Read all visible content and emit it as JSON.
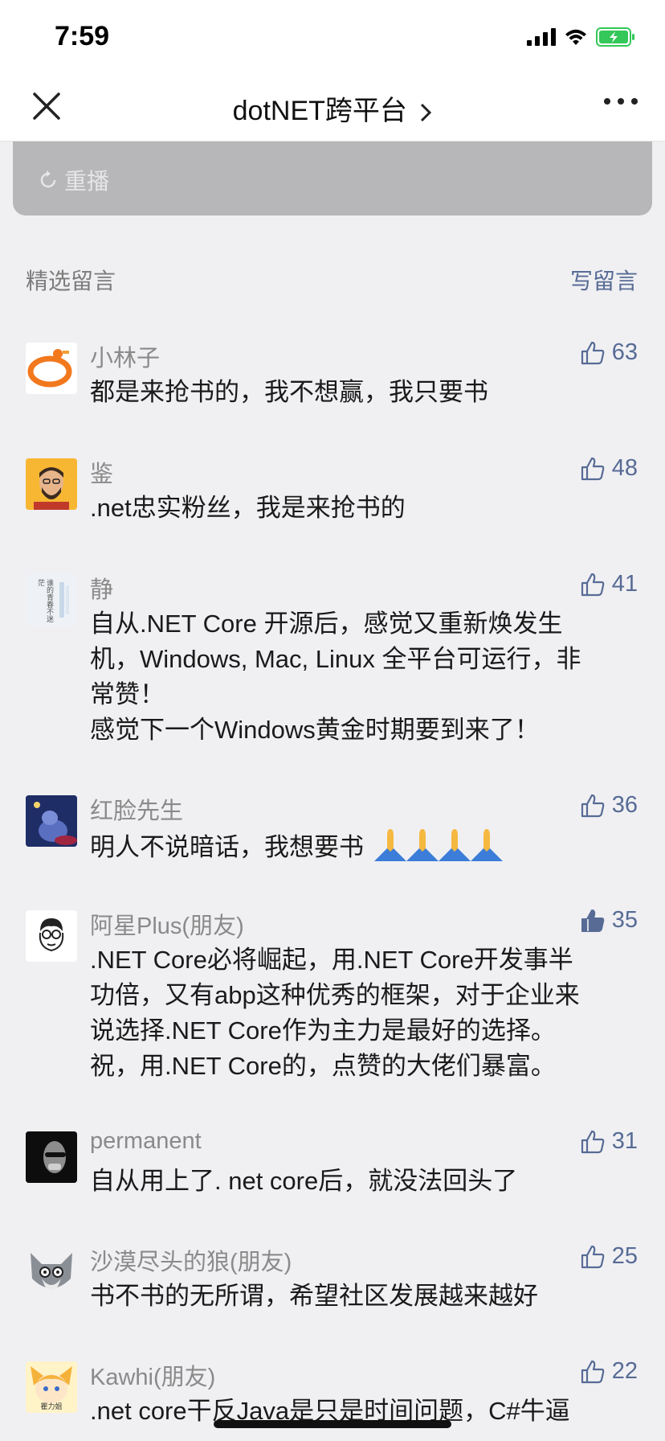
{
  "status_bar": {
    "time": "7:59"
  },
  "nav": {
    "title": "dotNET跨平台"
  },
  "video": {
    "replay_label": "重播"
  },
  "section": {
    "title": "精选留言",
    "write_label": "写留言"
  },
  "comments": [
    {
      "name": "小林子",
      "text": "都是来抢书的，我不想赢，我只要书",
      "likes": "63",
      "liked": false
    },
    {
      "name": "鉴",
      "text": ".net忠实粉丝，我是来抢书的",
      "likes": "48",
      "liked": false
    },
    {
      "name": "静",
      "text": "自从.NET Core 开源后，感觉又重新焕发生\n机，Windows, Mac, Linux 全平台可运行，非\n常赞！\n感觉下一个Windows黄金时期要到来了！",
      "likes": "41",
      "liked": false
    },
    {
      "name": "红脸先生",
      "text": "明人不说暗话，我想要书",
      "likes": "36",
      "liked": false
    },
    {
      "name": "阿星Plus(朋友)",
      "text": ".NET Core必将崛起，用.NET Core开发事半\n功倍，又有abp这种优秀的框架，对于企业来\n说选择.NET Core作为主力是最好的选择。\n祝，用.NET Core的，点赞的大佬们暴富。",
      "likes": "35",
      "liked": true
    },
    {
      "name": "permanent",
      "text": "自从用上了. net core后，就没法回头了",
      "likes": "31",
      "liked": false
    },
    {
      "name": "沙漠尽头的狼(朋友)",
      "text": "书不书的无所谓，希望社区发展越来越好",
      "likes": "25",
      "liked": false
    },
    {
      "name": "Kawhi(朋友)",
      "text": ".net core干反Java是只是时间问题，C#牛逼",
      "likes": "22",
      "liked": false
    }
  ],
  "avatar_4_caption": "谁的青春不迷茫",
  "avatar_8_caption": "瞿力姐",
  "colors": {
    "link": "#576b95",
    "background": "#f0f0f3",
    "name": "#8a8a8a",
    "battery": "#34c759"
  }
}
